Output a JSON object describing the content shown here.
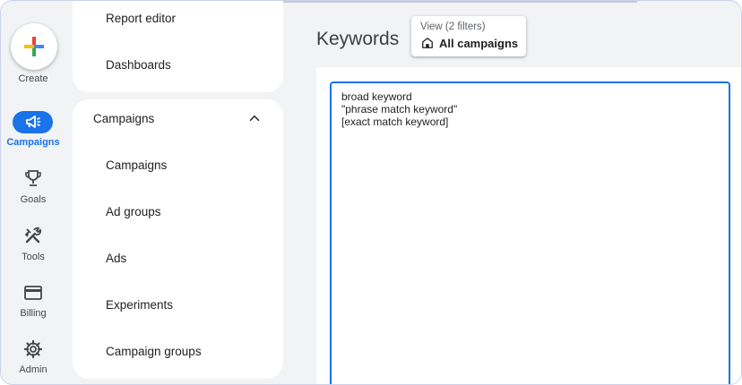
{
  "rail": {
    "create_label": "Create",
    "items": [
      {
        "label": "Campaigns",
        "icon": "megaphone-icon",
        "active": true
      },
      {
        "label": "Goals",
        "icon": "trophy-icon",
        "active": false
      },
      {
        "label": "Tools",
        "icon": "tools-icon",
        "active": false
      },
      {
        "label": "Billing",
        "icon": "credit-card-icon",
        "active": false
      },
      {
        "label": "Admin",
        "icon": "gear-icon",
        "active": false
      }
    ]
  },
  "nav": {
    "top_links": [
      "Report editor",
      "Dashboards"
    ],
    "section_title": "Campaigns",
    "section_links": [
      "Campaigns",
      "Ad groups",
      "Ads",
      "Experiments",
      "Campaign groups"
    ]
  },
  "main": {
    "title": "Keywords",
    "view_chip": {
      "top": "View (2 filters)",
      "bottom": "All campaigns"
    },
    "keywords_lines": [
      "broad keyword",
      "\"phrase match keyword\"",
      "[exact match keyword]"
    ]
  },
  "colors": {
    "accent": "#1a73e8",
    "rail_bg": "#f1f3f4"
  }
}
